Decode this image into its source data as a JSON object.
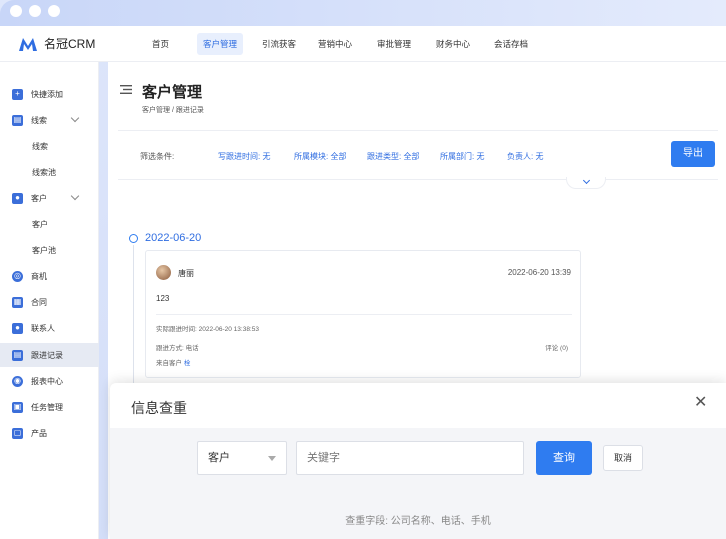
{
  "app": {
    "name": "名冠CRM",
    "brand_color": "#2f7cf0"
  },
  "topnav": {
    "items": [
      {
        "label": "首页"
      },
      {
        "label": "客户管理",
        "active": true
      },
      {
        "label": "引流获客"
      },
      {
        "label": "营销中心"
      },
      {
        "label": "审批管理"
      },
      {
        "label": "财务中心"
      },
      {
        "label": "会话存档"
      }
    ]
  },
  "sidebar": {
    "items": [
      {
        "label": "快捷添加",
        "icon": "plus-icon"
      },
      {
        "label": "线索",
        "icon": "clue-icon",
        "expandable": true
      },
      {
        "label": "线索",
        "sub": true
      },
      {
        "label": "线索池",
        "sub": true
      },
      {
        "label": "客户",
        "icon": "customer-icon",
        "expandable": true
      },
      {
        "label": "客户",
        "sub": true
      },
      {
        "label": "客户池",
        "sub": true
      },
      {
        "label": "商机",
        "icon": "opportunity-icon"
      },
      {
        "label": "合同",
        "icon": "contract-icon"
      },
      {
        "label": "联系人",
        "icon": "contacts-icon"
      },
      {
        "label": "跟进记录",
        "icon": "followup-icon",
        "active": true
      },
      {
        "label": "报表中心",
        "icon": "report-icon"
      },
      {
        "label": "任务管理",
        "icon": "task-icon"
      },
      {
        "label": "产品",
        "icon": "product-icon"
      }
    ]
  },
  "page": {
    "title": "客户管理",
    "breadcrumb": "客户管理  /  跟进记录"
  },
  "filters": {
    "label": "筛选条件:",
    "items": [
      "写跟进时间: 无",
      "所属模块: 全部",
      "跟进类型: 全部",
      "所属部门: 无",
      "负责人: 无"
    ],
    "export_label": "导出"
  },
  "timeline": {
    "date": "2022-06-20",
    "record": {
      "author": "唐丽",
      "time": "2022-06-20 13:39",
      "content": "123",
      "actual_time": "实际跟进时间: 2022-06-20 13:38:53",
      "method": "跟进方式: 电话",
      "source_label": "来自客户",
      "source_value": "栓",
      "comments": "评论 (0)"
    }
  },
  "dialog": {
    "title": "信息查重",
    "select_value": "客户",
    "input_placeholder": "关键字",
    "query_label": "查询",
    "cancel_label": "取消",
    "hint": "查重字段: 公司名称、电话、手机"
  }
}
